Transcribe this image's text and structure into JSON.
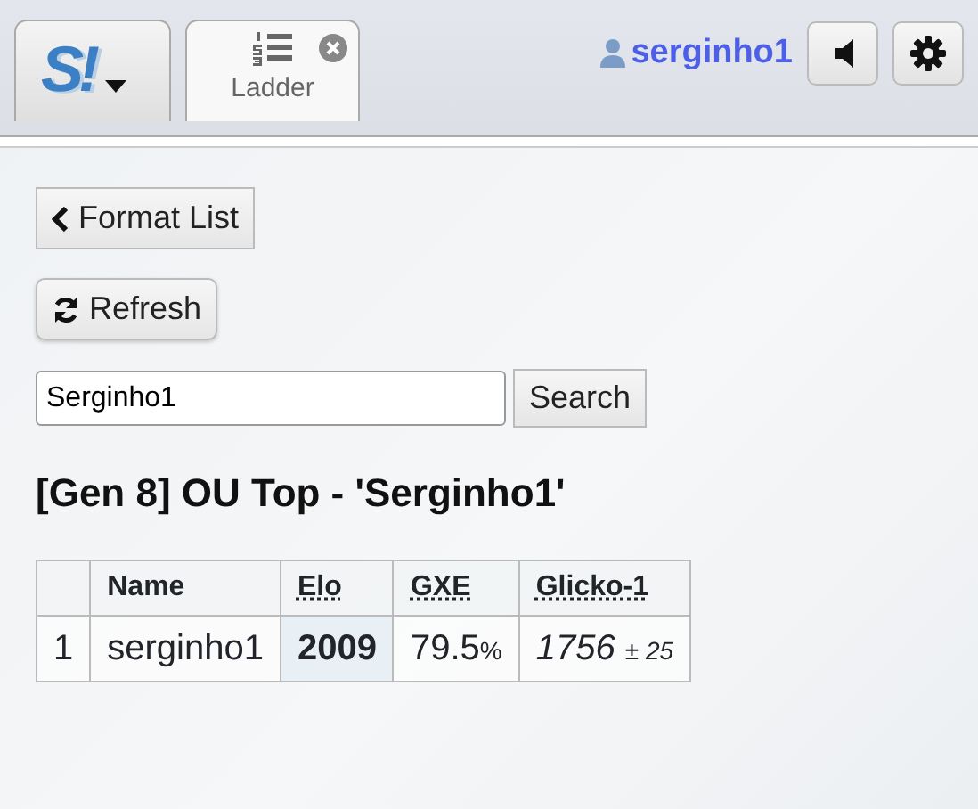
{
  "tabs": [
    {
      "kind": "logo",
      "label": "S!",
      "selected": false
    },
    {
      "kind": "room",
      "label": "Ladder",
      "selected": true
    }
  ],
  "user": {
    "name": "serginho1"
  },
  "buttons": {
    "back": "Format List",
    "refresh": "Refresh",
    "search": "Search"
  },
  "search": {
    "value": "Serginho1"
  },
  "heading": "[Gen 8] OU Top - 'Serginho1'",
  "table": {
    "columns": [
      "Name",
      "Elo",
      "GXE",
      "Glicko-1"
    ],
    "rows": [
      {
        "rank": "1",
        "name": "serginho1",
        "elo": "2009",
        "gxe": "79.5",
        "gxe_unit": "%",
        "glicko": "1756",
        "glicko_dev": "± 25"
      }
    ]
  }
}
